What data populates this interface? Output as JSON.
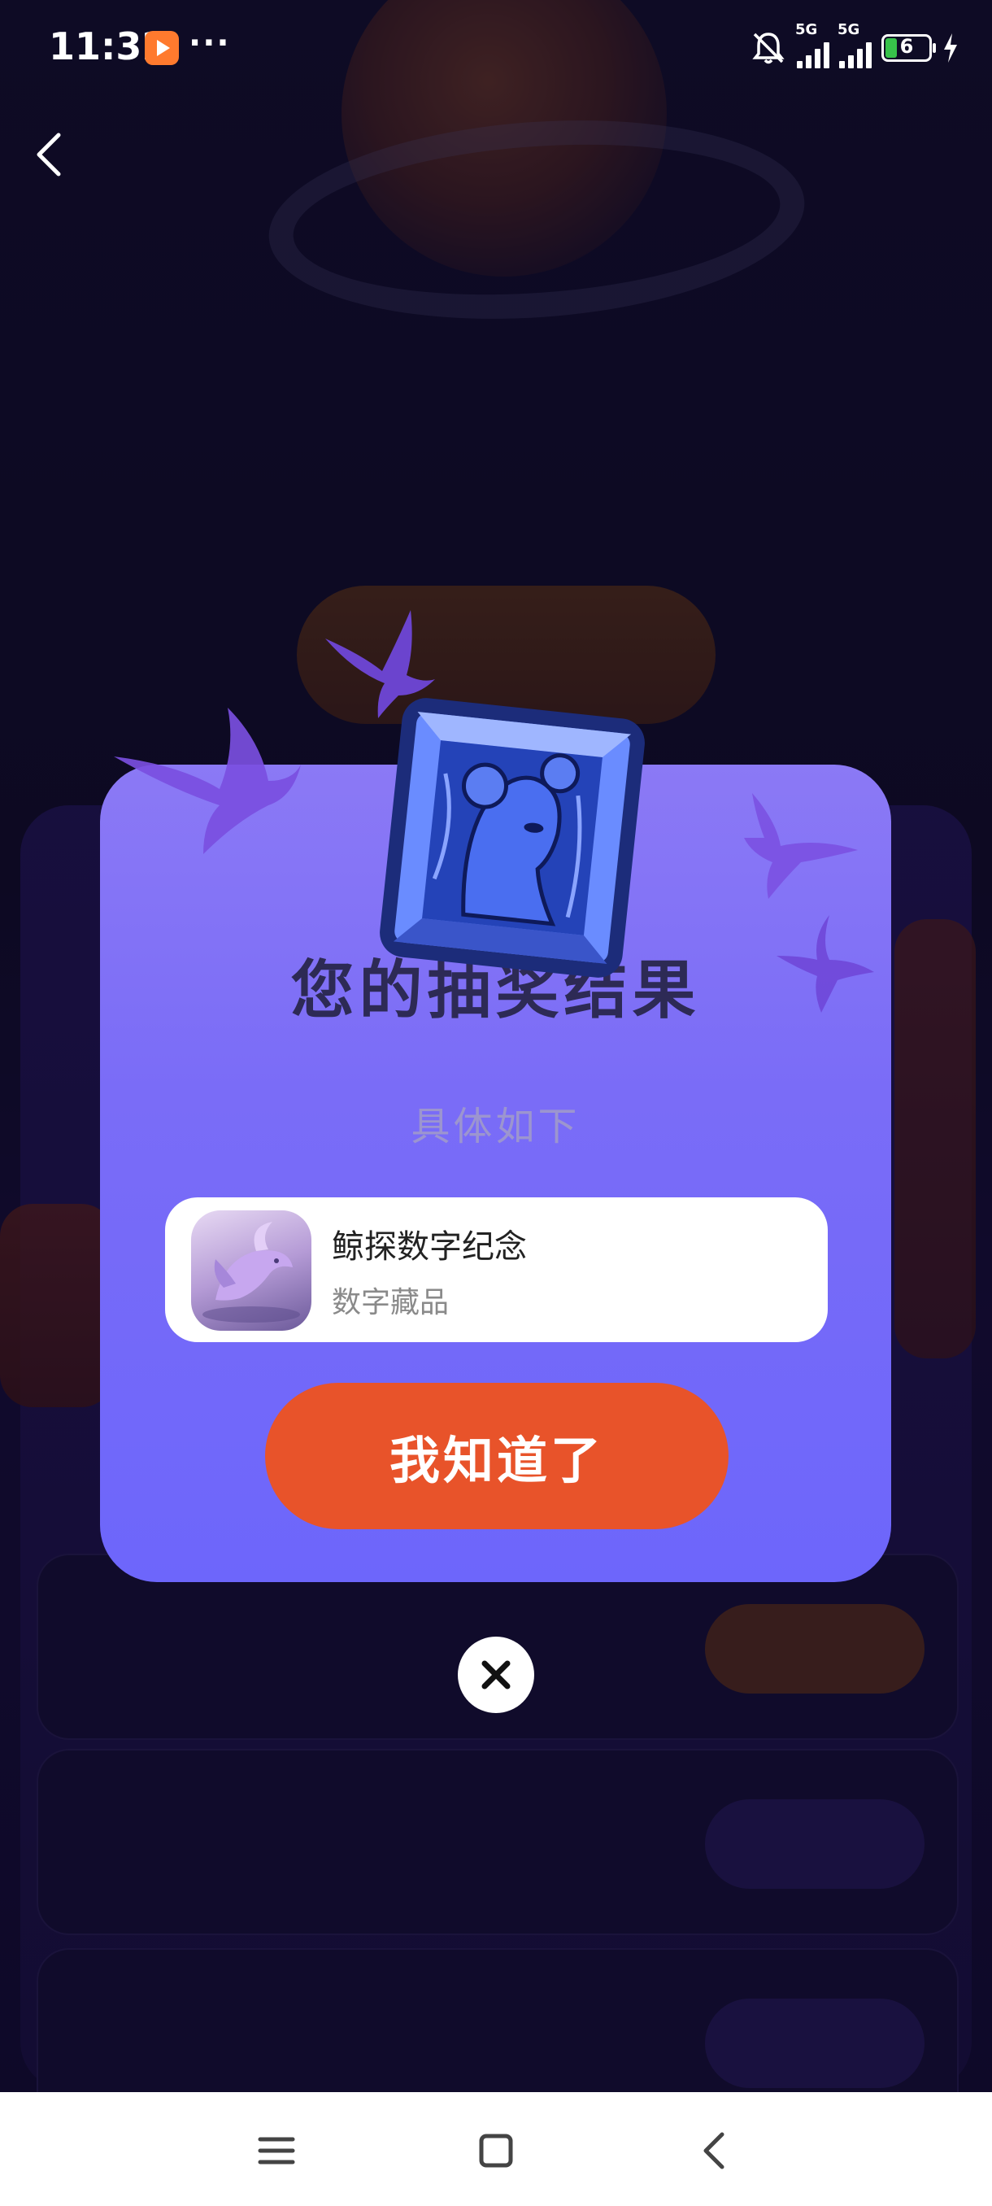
{
  "status_bar": {
    "time": "11:32",
    "more": "···",
    "signal1_label": "5G",
    "signal2_label": "5G",
    "battery_level": "6",
    "icons": [
      "app-notification-icon",
      "mute-icon",
      "signal-icon",
      "battery-icon",
      "charging-icon"
    ]
  },
  "modal": {
    "title": "您的抽奖结果",
    "subtitle": "具体如下",
    "prize": {
      "name": "鲸探数字纪念",
      "type": "数字藏品",
      "thumbnail_icon": "whale-collectible-icon"
    },
    "confirm_label": "我知道了",
    "close_icon": "close-icon"
  },
  "navigation_bar": {
    "icons": [
      "menu-icon",
      "home-icon",
      "back-icon"
    ]
  },
  "colors": {
    "modal_top": "#8b79f5",
    "modal_bottom": "#6d66fb",
    "confirm_button": "#e8532a",
    "title_text": "#2d2a55",
    "subtitle_text": "#9c95cf"
  }
}
